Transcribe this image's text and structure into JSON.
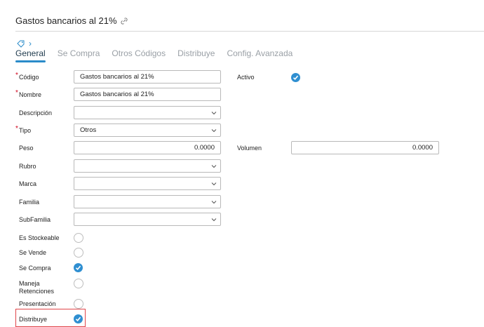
{
  "header": {
    "title": "Gastos bancarios al 21%"
  },
  "breadcrumb": {
    "chevron": "›"
  },
  "tabs": [
    {
      "label": "General"
    },
    {
      "label": "Se Compra"
    },
    {
      "label": "Otros Códigos"
    },
    {
      "label": "Distribuye"
    },
    {
      "label": "Config. Avanzada"
    }
  ],
  "form": {
    "codigo": {
      "label": "Código",
      "value": "Gastos bancarios al 21%"
    },
    "nombre": {
      "label": "Nombre",
      "value": "Gastos bancarios al 21%"
    },
    "descripcion": {
      "label": "Descripción",
      "value": ""
    },
    "tipo": {
      "label": "Tipo",
      "value": "Otros"
    },
    "peso": {
      "label": "Peso",
      "value": "0.0000"
    },
    "volumen": {
      "label": "Volumen",
      "value": "0.0000"
    },
    "rubro": {
      "label": "Rubro",
      "value": ""
    },
    "marca": {
      "label": "Marca",
      "value": ""
    },
    "familia": {
      "label": "Familia",
      "value": ""
    },
    "subfamilia": {
      "label": "SubFamilia",
      "value": ""
    },
    "activo": {
      "label": "Activo",
      "checked": true
    },
    "es_stockeable": {
      "label": "Es Stockeable",
      "checked": false
    },
    "se_vende": {
      "label": "Se Vende",
      "checked": false
    },
    "se_compra": {
      "label": "Se Compra",
      "checked": true
    },
    "maneja_retenciones": {
      "label_line1": "Maneja",
      "label_line2": "Retenciones",
      "checked": false
    },
    "presentacion": {
      "label": "Presentación",
      "checked": false
    },
    "distribuye": {
      "label": "Distribuye",
      "checked": true
    }
  },
  "colors": {
    "accent": "#2f8fd1",
    "required": "#d0021b",
    "highlight": "#e0454a"
  }
}
